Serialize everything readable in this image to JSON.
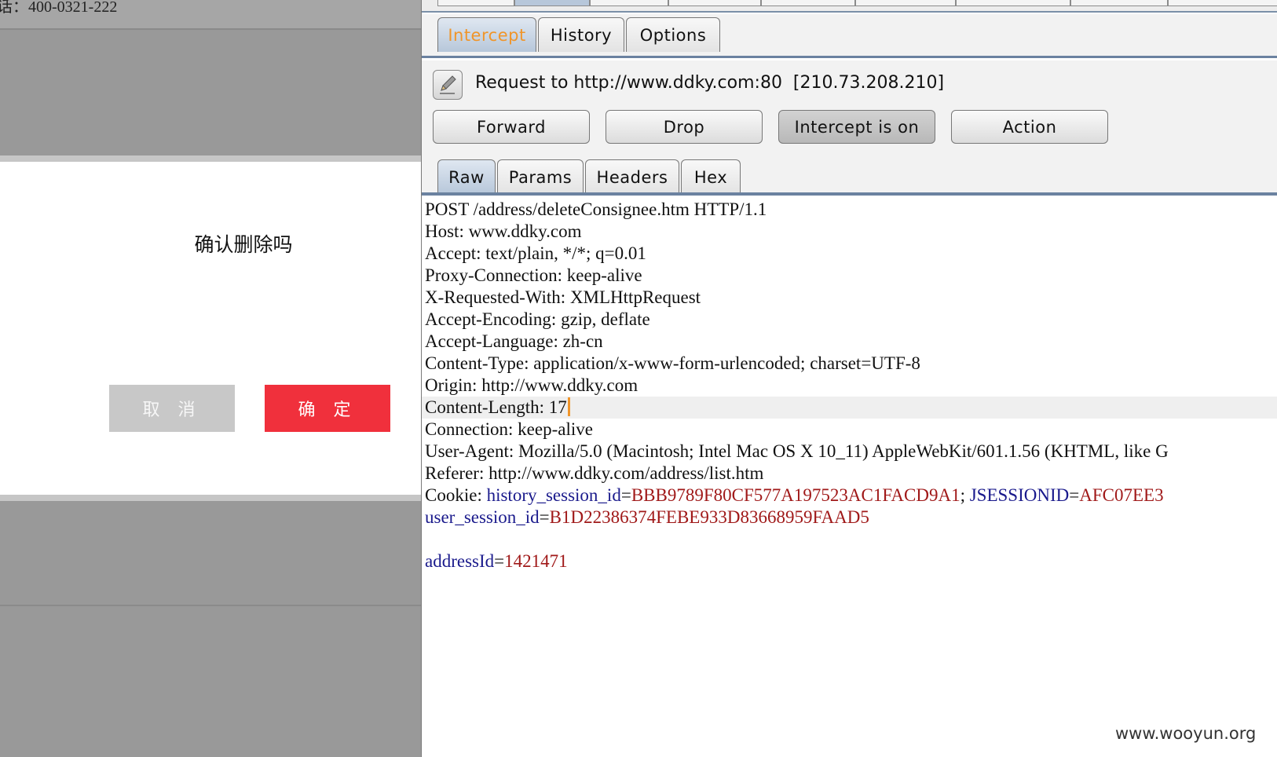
{
  "left_page": {
    "phone_text": "话：400-0321-222",
    "dialog": {
      "message": "确认删除吗",
      "cancel_label": "取 消",
      "confirm_label": "确 定"
    }
  },
  "burp": {
    "tabs": [
      {
        "label": "Intercept",
        "selected": true
      },
      {
        "label": "History",
        "selected": false
      },
      {
        "label": "Options",
        "selected": false
      }
    ],
    "request_to": "Request to http://www.ddky.com:80  [210.73.208.210]",
    "buttons": {
      "forward": "Forward",
      "drop": "Drop",
      "intercept_toggle": "Intercept is on",
      "action": "Action"
    },
    "view_tabs": [
      {
        "label": "Raw",
        "selected": true
      },
      {
        "label": "Params",
        "selected": false
      },
      {
        "label": "Headers",
        "selected": false
      },
      {
        "label": "Hex",
        "selected": false
      }
    ],
    "request_lines": [
      "POST /address/deleteConsignee.htm HTTP/1.1",
      "Host: www.ddky.com",
      "Accept: text/plain, */*; q=0.01",
      "Proxy-Connection: keep-alive",
      "X-Requested-With: XMLHttpRequest",
      "Accept-Encoding: gzip, deflate",
      "Accept-Language: zh-cn",
      "Content-Type: application/x-www-form-urlencoded; charset=UTF-8",
      "Origin: http://www.ddky.com",
      "Content-Length: 17",
      "Connection: keep-alive",
      "User-Agent: Mozilla/5.0 (Macintosh; Intel Mac OS X 10_11) AppleWebKit/601.1.56 (KHTML, like G",
      "Referer: http://www.ddky.com/address/list.htm"
    ],
    "cookie": {
      "prefix": "Cookie: ",
      "history_session_key": "history_session_id",
      "history_session_value": "BBB9789F80CF577A197523AC1FACD9A1",
      "separator": "; ",
      "jsession_key": "JSESSIONID",
      "jsession_value": "AFC07EE3",
      "user_session_key": "user_session_id",
      "user_session_value": "B1D22386374FEBE933D83668959FAAD5"
    },
    "body_param": {
      "key": "addressId",
      "value": "1421471"
    }
  },
  "watermark": "www.wooyun.org"
}
